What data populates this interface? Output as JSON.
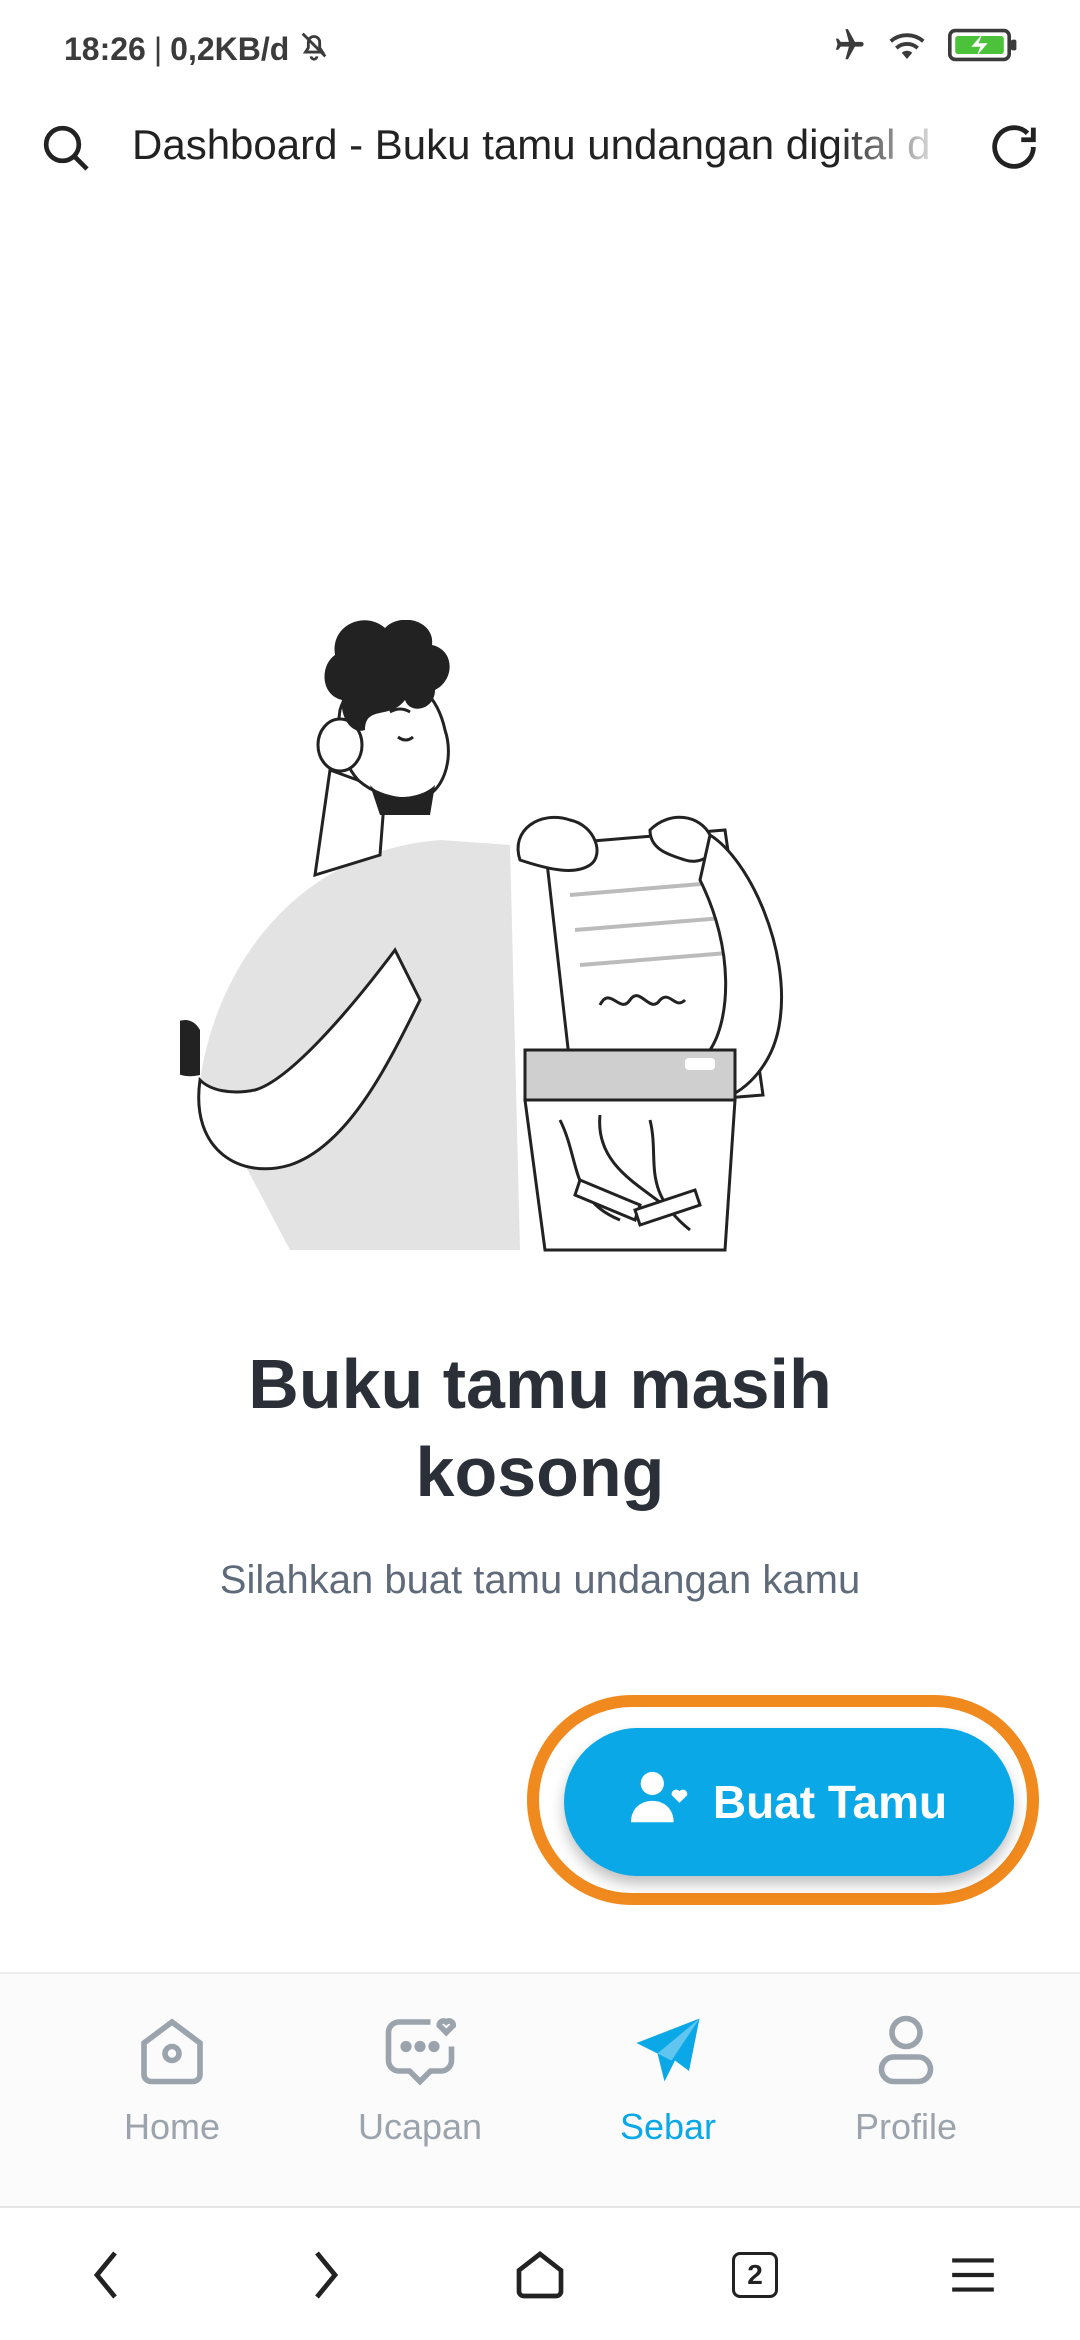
{
  "status_bar": {
    "time": "18:26",
    "network_speed": "0,2KB/d",
    "separator": "|",
    "icons": [
      "bell-off-icon",
      "airplane-icon",
      "wifi-icon",
      "battery-charging-icon"
    ]
  },
  "browser": {
    "page_title": "Dashboard - Buku tamu undangan digital d",
    "icons": [
      "search-icon",
      "reload-icon"
    ]
  },
  "empty_state": {
    "title": "Buku tamu masih kosong",
    "subtitle": "Silahkan buat tamu undangan kamu"
  },
  "cta": {
    "label": "Buat Tamu",
    "icon": "add-user-icon"
  },
  "bottom_nav": {
    "items": [
      {
        "label": "Home",
        "icon": "home-icon",
        "active": false
      },
      {
        "label": "Ucapan",
        "icon": "chat-heart-icon",
        "active": false
      },
      {
        "label": "Sebar",
        "icon": "send-icon",
        "active": true
      },
      {
        "label": "Profile",
        "icon": "profile-icon",
        "active": false
      }
    ]
  },
  "system_nav": {
    "tab_count": "2",
    "icons": [
      "back-icon",
      "forward-icon",
      "home-outline-icon",
      "tabs-icon",
      "menu-icon"
    ]
  },
  "colors": {
    "accent": "#0ba8e8",
    "highlight_ring": "#f08a1e",
    "title_text": "#2b3038",
    "subtitle_text": "#5f6b7a",
    "nav_inactive": "#9ba3ad"
  }
}
